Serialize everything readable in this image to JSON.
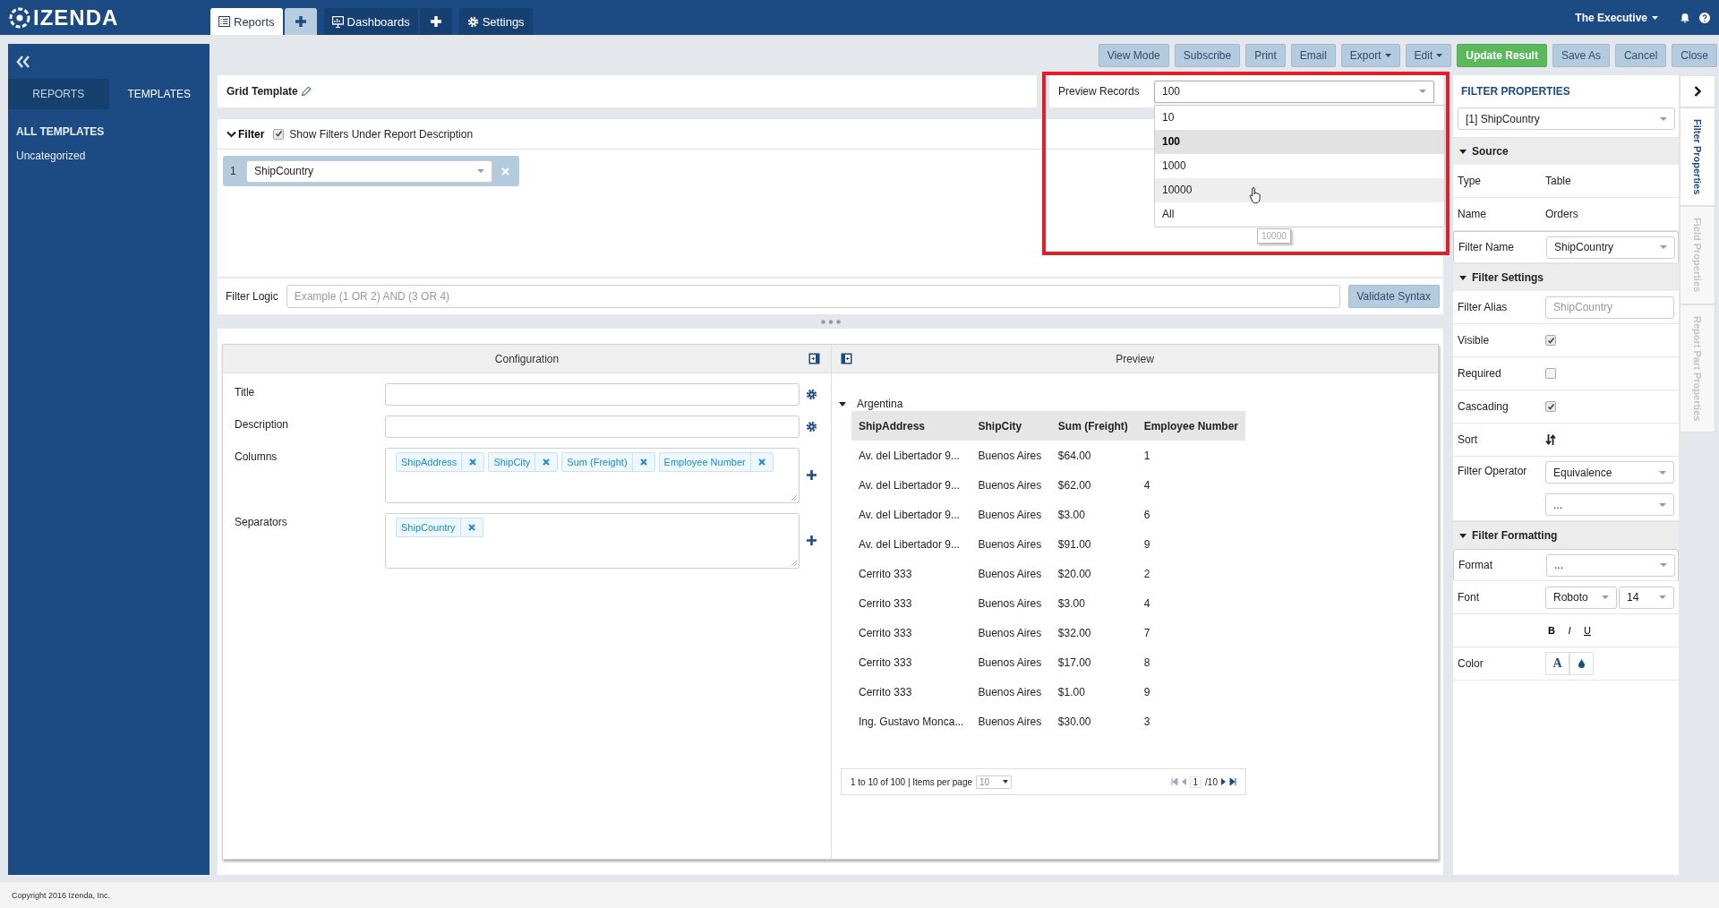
{
  "topbar": {
    "logo": "IZENDA",
    "user": "The Executive",
    "tabs": [
      {
        "label": "Reports",
        "selected": true,
        "add_button": true
      },
      {
        "label": "Dashboards",
        "selected": false,
        "add_button": true
      },
      {
        "label": "Settings",
        "selected": false,
        "add_button": false
      }
    ]
  },
  "sidebar": {
    "tabs": [
      {
        "label": "REPORTS",
        "selected": false
      },
      {
        "label": "TEMPLATES",
        "selected": true
      }
    ],
    "items": [
      {
        "label": "ALL TEMPLATES",
        "selected": true
      },
      {
        "label": "Uncategorized",
        "selected": false
      }
    ]
  },
  "toolbar": [
    {
      "label": "View Mode",
      "kind": "plain"
    },
    {
      "label": "Subscribe",
      "kind": "plain"
    },
    {
      "label": "Print",
      "kind": "plain"
    },
    {
      "label": "Email",
      "kind": "plain"
    },
    {
      "label": "Export",
      "kind": "menu"
    },
    {
      "label": "Edit",
      "kind": "menu"
    },
    {
      "label": "Update Result",
      "kind": "primary"
    },
    {
      "label": "Save As",
      "kind": "plain"
    },
    {
      "label": "Cancel",
      "kind": "plain"
    },
    {
      "label": "Close",
      "kind": "plain"
    }
  ],
  "report": {
    "title": "Grid Template"
  },
  "preview_records": {
    "label": "Preview Records",
    "value": "100",
    "expanded": true,
    "highlighted": true,
    "tooltip": "10000",
    "options": [
      {
        "label": "10",
        "selected": false,
        "hovered": false
      },
      {
        "label": "100",
        "selected": true,
        "hovered": false
      },
      {
        "label": "1000",
        "selected": false,
        "hovered": false
      },
      {
        "label": "10000",
        "selected": false,
        "hovered": true
      },
      {
        "label": "All",
        "selected": false,
        "hovered": false
      }
    ]
  },
  "filter": {
    "title": "Filter",
    "expanded": true,
    "show_under_description": {
      "label": "Show Filters Under Report Description",
      "checked": true
    },
    "items": [
      {
        "number": "1",
        "field": "ShipCountry"
      }
    ],
    "logic": {
      "label": "Filter Logic",
      "placeholder": "Example (1 OR 2) AND (3 OR 4)",
      "button": "Validate Syntax"
    }
  },
  "configuration": {
    "title": "Configuration",
    "fields": [
      {
        "label": "Title",
        "kind": "text"
      },
      {
        "label": "Description",
        "kind": "text"
      },
      {
        "label": "Columns",
        "kind": "chips",
        "chips": [
          "ShipAddress",
          "ShipCity",
          "Sum (Freight)",
          "Employee Number"
        ]
      },
      {
        "label": "Separators",
        "kind": "chips",
        "chips": [
          "ShipCountry"
        ]
      }
    ]
  },
  "preview": {
    "title": "Preview",
    "group": {
      "label": "Argentina",
      "expanded": true
    },
    "columns": [
      "ShipAddress",
      "ShipCity",
      "Sum (Freight)",
      "Employee Number"
    ],
    "rows": [
      [
        "Av. del Libertador 9...",
        "Buenos Aires",
        "$64.00",
        "1"
      ],
      [
        "Av. del Libertador 9...",
        "Buenos Aires",
        "$62.00",
        "4"
      ],
      [
        "Av. del Libertador 9...",
        "Buenos Aires",
        "$3.00",
        "6"
      ],
      [
        "Av. del Libertador 9...",
        "Buenos Aires",
        "$91.00",
        "9"
      ],
      [
        "Cerrito 333",
        "Buenos Aires",
        "$20.00",
        "2"
      ],
      [
        "Cerrito 333",
        "Buenos Aires",
        "$3.00",
        "4"
      ],
      [
        "Cerrito 333",
        "Buenos Aires",
        "$32.00",
        "7"
      ],
      [
        "Cerrito 333",
        "Buenos Aires",
        "$17.00",
        "8"
      ],
      [
        "Cerrito 333",
        "Buenos Aires",
        "$1.00",
        "9"
      ],
      [
        "Ing. Gustavo Monca...",
        "Buenos Aires",
        "$30.00",
        "3"
      ]
    ],
    "pager": {
      "summary": "1 to 10 of 100 | Items per page",
      "per_page": "10",
      "page": "1",
      "total": "/10"
    }
  },
  "properties": {
    "title": "FILTER PROPERTIES",
    "selector": "[1] ShipCountry",
    "sections": [
      {
        "title": "Source",
        "expanded": true,
        "rows": [
          {
            "kind": "text",
            "label": "Type",
            "value": "Table"
          },
          {
            "kind": "text",
            "label": "Name",
            "value": "Orders"
          },
          {
            "kind": "select",
            "label": "Filter Name",
            "value": "ShipCountry"
          }
        ]
      },
      {
        "title": "Filter Settings",
        "expanded": true,
        "rows": [
          {
            "kind": "input",
            "label": "Filter Alias",
            "placeholder": "ShipCountry"
          },
          {
            "kind": "checkbox",
            "label": "Visible",
            "checked": true
          },
          {
            "kind": "checkbox",
            "label": "Required",
            "checked": false
          },
          {
            "kind": "checkbox",
            "label": "Cascading",
            "checked": true
          },
          {
            "kind": "sort",
            "label": "Sort"
          },
          {
            "kind": "selects",
            "label": "Filter Operator",
            "values": [
              "Equivalence",
              "..."
            ]
          }
        ]
      },
      {
        "title": "Filter Formatting",
        "expanded": true,
        "rows": [
          {
            "kind": "select",
            "label": "Format",
            "value": "..."
          },
          {
            "kind": "font",
            "label": "Font",
            "values": [
              "Roboto",
              "14"
            ]
          },
          {
            "kind": "styles",
            "buttons": [
              "B",
              "I",
              "U"
            ]
          },
          {
            "kind": "color",
            "label": "Color",
            "text_button": "A"
          }
        ]
      }
    ]
  },
  "side_tabs": [
    {
      "label": "Filter Properties",
      "selected": true
    },
    {
      "label": "Field Properties",
      "selected": false
    },
    {
      "label": "Report Part Properties",
      "selected": false
    }
  ],
  "footer": "Copyright 2016 Izenda, Inc."
}
